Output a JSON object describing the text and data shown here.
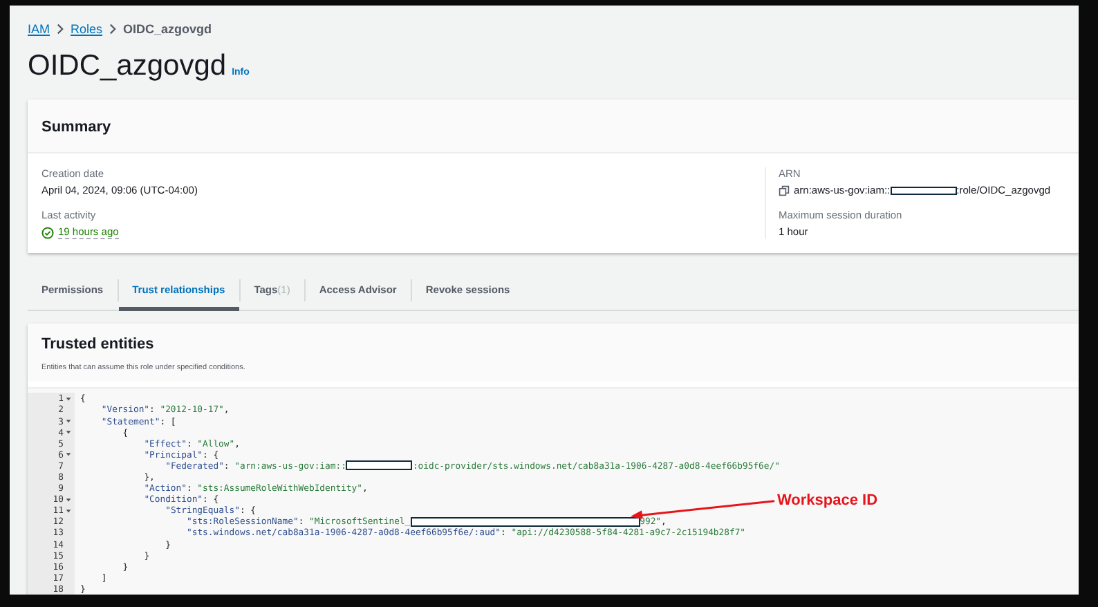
{
  "breadcrumb": [
    {
      "label": "IAM",
      "link": true
    },
    {
      "label": "Roles",
      "link": true
    },
    {
      "label": "OIDC_azgovgd",
      "link": false
    }
  ],
  "title": "OIDC_azgovgd",
  "info": "Info",
  "summary": {
    "heading": "Summary",
    "left": [
      {
        "label": "Creation date",
        "value": "April 04, 2024, 09:06 (UTC-04:00)",
        "kind": "text"
      },
      {
        "label": "Last activity",
        "value": "19 hours ago",
        "kind": "status"
      }
    ],
    "arn": {
      "label": "ARN",
      "prefix": "arn:aws-us-gov:iam::",
      "suffix": ":role/OIDC_azgovgd"
    },
    "duration": {
      "label": "Maximum session duration",
      "value": "1 hour"
    }
  },
  "tabs": [
    {
      "label": "Permissions",
      "selected": false
    },
    {
      "label": "Trust relationships",
      "selected": true
    },
    {
      "label": "Tags",
      "count": "(1)",
      "selected": false
    },
    {
      "label": "Access Advisor",
      "selected": false
    },
    {
      "label": "Revoke sessions",
      "selected": false
    }
  ],
  "trusted": {
    "heading": "Trusted entities",
    "description": "Entities that can assume this role under specified conditions.",
    "code": [
      {
        "number": "1",
        "tokens": [
          {
            "kind": "punct",
            "text": "{"
          }
        ],
        "children": [
          {
            "number": "2",
            "tokens": [
              {
                "kind": "key",
                "text": "\"Version\""
              },
              {
                "kind": "punct",
                "text": ": "
              },
              {
                "kind": "string",
                "text": "\"2012-10-17\""
              },
              {
                "kind": "punct",
                "text": ","
              }
            ]
          },
          {
            "number": "3",
            "tokens": [
              {
                "kind": "key",
                "text": "\"Statement\""
              },
              {
                "kind": "punct",
                "text": ": ["
              }
            ],
            "children": [
              {
                "number": "4",
                "tokens": [
                  {
                    "kind": "punct",
                    "text": "{"
                  }
                ],
                "children": [
                  {
                    "number": "5",
                    "tokens": [
                      {
                        "kind": "key",
                        "text": "\"Effect\""
                      },
                      {
                        "kind": "punct",
                        "text": ": "
                      },
                      {
                        "kind": "string",
                        "text": "\"Allow\""
                      },
                      {
                        "kind": "punct",
                        "text": ","
                      }
                    ]
                  },
                  {
                    "number": "6",
                    "tokens": [
                      {
                        "kind": "key",
                        "text": "\"Principal\""
                      },
                      {
                        "kind": "punct",
                        "text": ": {"
                      }
                    ],
                    "children": [
                      {
                        "number": "7",
                        "tokens": [
                          {
                            "kind": "key",
                            "text": "\"Federated\""
                          },
                          {
                            "kind": "punct",
                            "text": ": "
                          },
                          {
                            "kind": "string",
                            "text": "\"arn:aws-us-gov:iam::"
                          },
                          {
                            "kind": "redacted"
                          },
                          {
                            "kind": "string",
                            "text": ":oidc-provider/sts.windows.net/cab8a31a-1906-4287-a0d8-4eef66b95f6e/\""
                          }
                        ]
                      }
                    ]
                  },
                  {
                    "number": "8",
                    "tokens": [
                      {
                        "kind": "punct",
                        "text": "},"
                      }
                    ]
                  },
                  {
                    "number": "9",
                    "tokens": [
                      {
                        "kind": "key",
                        "text": "\"Action\""
                      },
                      {
                        "kind": "punct",
                        "text": ": "
                      },
                      {
                        "kind": "string",
                        "text": "\"sts:AssumeRoleWithWebIdentity\""
                      },
                      {
                        "kind": "punct",
                        "text": ","
                      }
                    ]
                  },
                  {
                    "number": "10",
                    "tokens": [
                      {
                        "kind": "key",
                        "text": "\"Condition\""
                      },
                      {
                        "kind": "punct",
                        "text": ": {"
                      }
                    ],
                    "children": [
                      {
                        "number": "11",
                        "tokens": [
                          {
                            "kind": "key",
                            "text": "\"StringEquals\""
                          },
                          {
                            "kind": "punct",
                            "text": ": {"
                          }
                        ],
                        "children": [
                          {
                            "number": "12",
                            "tokens": [
                              {
                                "kind": "key",
                                "text": "\"sts:RoleSessionName\""
                              },
                              {
                                "kind": "punct",
                                "text": ": "
                              },
                              {
                                "kind": "string",
                                "text": "\"MicrosoftSentinel_"
                              },
                              {
                                "kind": "redactedwide"
                              },
                              {
                                "kind": "string",
                                "text": "992\""
                              },
                              {
                                "kind": "punct",
                                "text": ","
                              }
                            ]
                          },
                          {
                            "number": "13",
                            "tokens": [
                              {
                                "kind": "key",
                                "text": "\"sts.windows.net/cab8a31a-1906-4287-a0d8-4eef66b95f6e/:aud\""
                              },
                              {
                                "kind": "punct",
                                "text": ": "
                              },
                              {
                                "kind": "string",
                                "text": "\"api://d4230588-5f84-4281-a9c7-2c15194b28f7\""
                              }
                            ]
                          }
                        ]
                      },
                      {
                        "number": "14",
                        "tokens": [
                          {
                            "kind": "punct",
                            "text": "}"
                          }
                        ]
                      }
                    ]
                  },
                  {
                    "number": "15",
                    "tokens": [
                      {
                        "kind": "punct",
                        "text": "}"
                      }
                    ]
                  }
                ]
              },
              {
                "number": "16",
                "tokens": [
                  {
                    "kind": "punct",
                    "text": "}"
                  }
                ]
              }
            ]
          },
          {
            "number": "17",
            "tokens": [
              {
                "kind": "punct",
                "text": "]"
              }
            ]
          }
        ]
      },
      {
        "number": "18",
        "tokens": [
          {
            "kind": "punct",
            "text": "}"
          }
        ]
      }
    ],
    "annotation": {
      "label": "Workspace ID"
    }
  }
}
